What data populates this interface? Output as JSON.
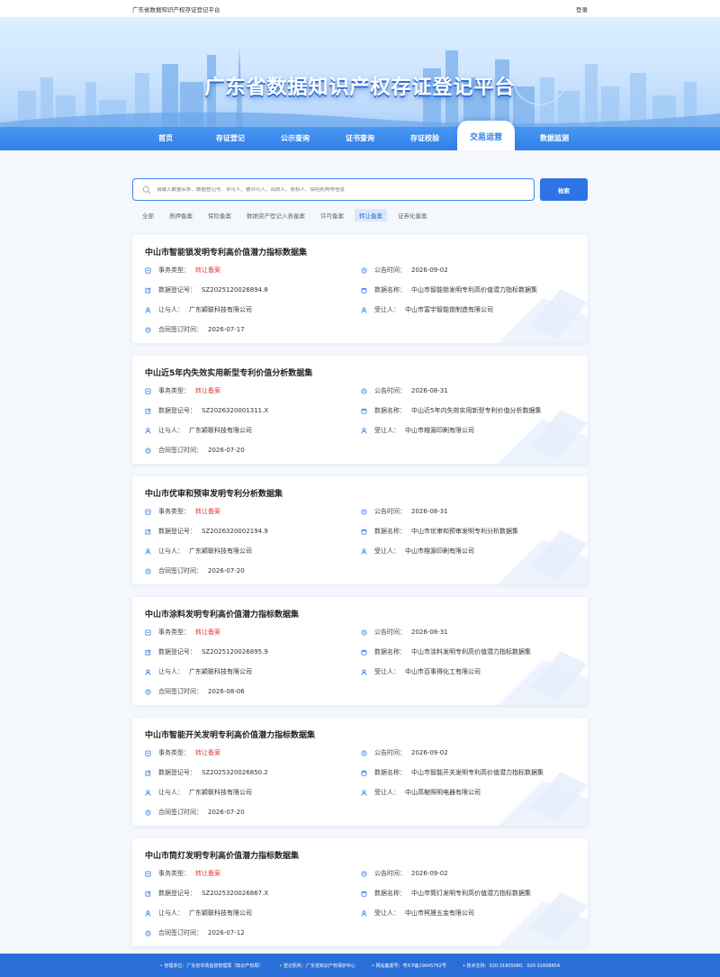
{
  "topbar": {
    "site_name": "广东省数据知识产权存证登记平台",
    "login": "登录"
  },
  "hero": {
    "title": "广东省数据知识产权存证登记平台"
  },
  "nav": [
    {
      "label": "首页"
    },
    {
      "label": "存证登记"
    },
    {
      "label": "公示查询"
    },
    {
      "label": "证书查询"
    },
    {
      "label": "存证校验"
    },
    {
      "label": "交易运营",
      "active": true
    },
    {
      "label": "数据监测"
    }
  ],
  "search": {
    "placeholder": "请输入数据名称、数据登记号、许可人、被许可人、出质人、质权人、保险机构等信息",
    "button": "检索"
  },
  "filters": [
    {
      "label": "全部"
    },
    {
      "label": "质押备案"
    },
    {
      "label": "保险备案"
    },
    {
      "label": "数据资产登记入表备案"
    },
    {
      "label": "许可备案"
    },
    {
      "label": "转让备案",
      "active": true
    },
    {
      "label": "证券化备案"
    }
  ],
  "labels": {
    "type": "事务类型：",
    "publish": "公告时间：",
    "reg_no": "数据登记号：",
    "data_name": "数据名称：",
    "transferor": "让与人：",
    "transferee": "受让人：",
    "signed": "合同签订时间："
  },
  "records": [
    {
      "title": "中山市智能锁发明专利高价值潜力指标数据集",
      "type": "转让备案",
      "publish": "2026-09-02",
      "reg_no": "SZ2025120026894.8",
      "data_name": "中山市智能锁发明专利高价值潜力指标数据集",
      "transferor": "广东颖联科技有限公司",
      "transferee": "中山市富宇智能锁制造有限公司",
      "signed": "2026-07-17"
    },
    {
      "title": "中山近5年内失效实用新型专利价值分析数据集",
      "type": "转让备案",
      "publish": "2026-08-31",
      "reg_no": "SZ2026320001311.X",
      "data_name": "中山近5年内失效实用新型专利价值分析数据集",
      "transferor": "广东颖联科技有限公司",
      "transferee": "中山市榕源印刷有限公司",
      "signed": "2026-07-20"
    },
    {
      "title": "中山市优审和预审发明专利分析数据集",
      "type": "转让备案",
      "publish": "2026-08-31",
      "reg_no": "SZ2026320002194.9",
      "data_name": "中山市优审和预审发明专利分析数据集",
      "transferor": "广东颖联科技有限公司",
      "transferee": "中山市榕源印刷有限公司",
      "signed": "2026-07-20"
    },
    {
      "title": "中山市涂料发明专利高价值潜力指标数据集",
      "type": "转让备案",
      "publish": "2026-08-31",
      "reg_no": "SZ2025120026895.9",
      "data_name": "中山市涂料发明专利高价值潜力指标数据集",
      "transferor": "广东颖联科技有限公司",
      "transferee": "中山市百事得化工有限公司",
      "signed": "2026-08-06"
    },
    {
      "title": "中山市智能开关发明专利高价值潜力指标数据集",
      "type": "转让备案",
      "publish": "2026-09-02",
      "reg_no": "SZ2025320026850.2",
      "data_name": "中山市智能开关发明专利高价值潜力指标数据集",
      "transferor": "广东颖联科技有限公司",
      "transferee": "中山高榭照明电器有限公司",
      "signed": "2026-07-20"
    },
    {
      "title": "中山市筒灯发明专利高价值潜力指标数据集",
      "type": "转让备案",
      "publish": "2026-09-02",
      "reg_no": "SZ2025320026867.X",
      "data_name": "中山市筒灯发明专利高价值潜力指标数据集",
      "transferor": "广东颖联科技有限公司",
      "transferee": "中山市柯晟五金有限公司",
      "signed": "2026-07-12"
    }
  ],
  "footer": [
    {
      "text": "管理单位：广东省市场监督管理局（知识产权局）"
    },
    {
      "text": "登记机构：广东省知识产权保护中心"
    },
    {
      "text": "网站备案号：粤ICP备19045762号"
    },
    {
      "text": "技术支持：020-31605060、020-31608654"
    }
  ],
  "colors": {
    "primary": "#2f7fe8",
    "nav_bg": "#3a8aee",
    "status_red": "#e03c31",
    "filter_active_bg": "#d9e8fb"
  }
}
